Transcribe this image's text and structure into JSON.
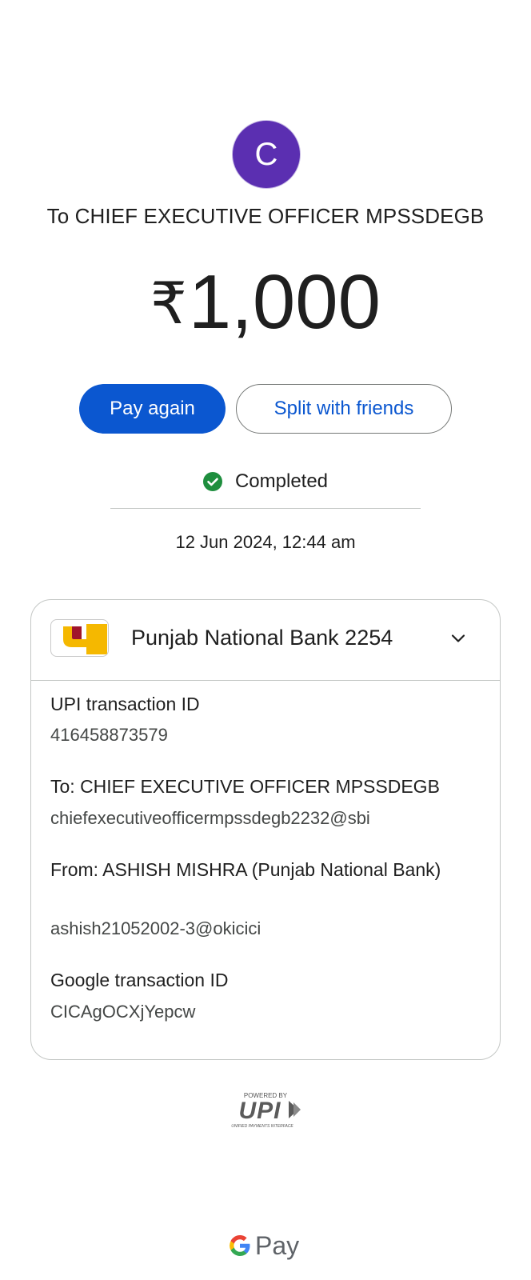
{
  "payee": {
    "initial": "C",
    "title": "To CHIEF EXECUTIVE OFFICER MPSSDEGB",
    "avatar_color": "#5b2fb1"
  },
  "amount": {
    "currency": "₹",
    "value": "1,000"
  },
  "actions": {
    "pay_again": "Pay again",
    "split": "Split with friends"
  },
  "status": {
    "label": "Completed",
    "color": "#1e8e3e"
  },
  "datetime": "12 Jun 2024, 12:44 am",
  "bank": {
    "name": "Punjab National Bank 2254"
  },
  "details": [
    {
      "label": "UPI transaction ID",
      "value": "416458873579"
    },
    {
      "label": "To: CHIEF EXECUTIVE OFFICER MPSSDEGB",
      "value": "chiefexecutiveofficermpssdegb2232@sbi"
    },
    {
      "label": "From: ASHISH MISHRA (Punjab National Bank)",
      "value": "ashish21052002-3@okicici"
    },
    {
      "label": "Google transaction ID",
      "value": "CICAgOCXjYepcw"
    }
  ],
  "upi_badge": {
    "powered_by": "POWERED BY",
    "wordmark": "UPI",
    "tagline": "UNIFIED PAYMENTS INTERFACE"
  },
  "footer": {
    "brand_g": "G",
    "brand_pay": "Pay"
  },
  "colors": {
    "primary": "#0b57d0",
    "pnb_yellow": "#f5b800",
    "pnb_maroon": "#a0152b"
  }
}
